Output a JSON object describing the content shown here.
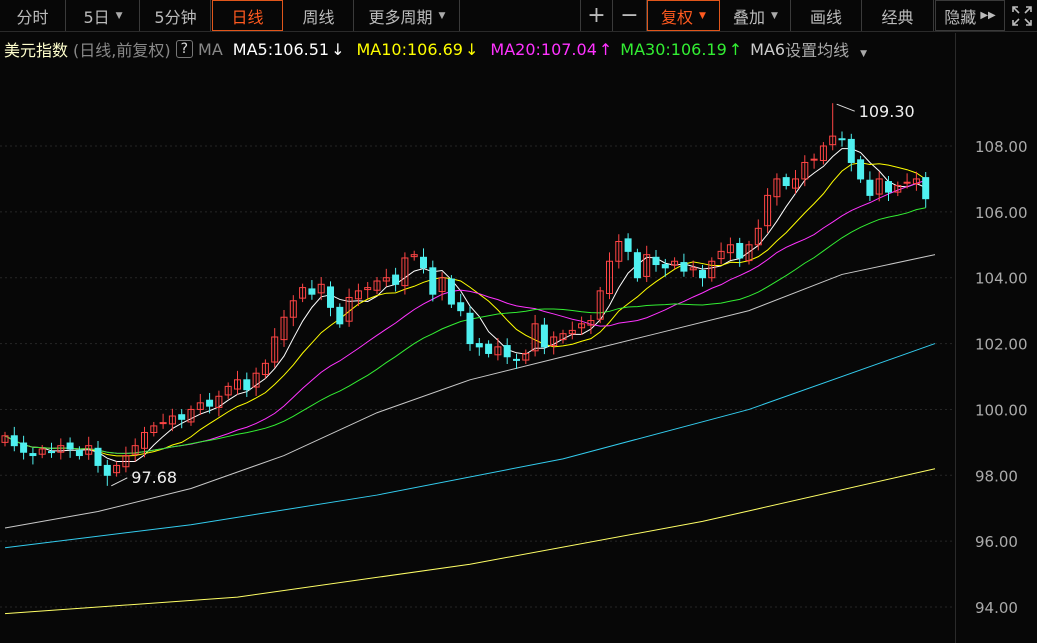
{
  "toolbar": {
    "periods": [
      {
        "label": "分时"
      },
      {
        "label": "5日",
        "dropdown": true
      },
      {
        "label": "5分钟"
      },
      {
        "label": "日线",
        "active": true
      },
      {
        "label": "周线"
      },
      {
        "label": "更多周期",
        "dropdown": true
      }
    ],
    "zoom_in": "+",
    "zoom_out": "−",
    "fuquan": "复权",
    "diejia": "叠加",
    "huaxian": "画线",
    "jingdian": "经典",
    "hide": "隐藏"
  },
  "legend": {
    "name": "美元指数",
    "mode": "(日线,前复权)",
    "help": "?",
    "ma_label": "MA",
    "ma5": "MA5:106.51",
    "ma5_arrow": "↓",
    "ma10": "MA10:106.69",
    "ma10_arrow": "↓",
    "ma20": "MA20:107.04",
    "ma20_arrow": "↑",
    "ma30": "MA30:106.19",
    "ma30_arrow": "↑",
    "ma60": "MA6",
    "settings": "设置均线"
  },
  "colors": {
    "up": "#ff4545",
    "down": "#4ff0f0",
    "ma5": "#ffffff",
    "ma10": "#ffff00",
    "ma20": "#ff33ff",
    "ma30": "#33ee33",
    "ma60": "#c8c8c8",
    "ma120": "#33ccee",
    "ma250": "#ffff66"
  },
  "chart_data": {
    "type": "candlestick",
    "title": "美元指数 日线",
    "ylim": [
      93.6,
      110.5
    ],
    "y_ticks": [
      "108.00",
      "106.00",
      "104.00",
      "102.00",
      "100.00",
      "98.00",
      "96.00",
      "94.00"
    ],
    "y_tick_values": [
      108,
      106,
      104,
      102,
      100,
      98,
      96,
      94
    ],
    "first_open": 99.0,
    "closes": [
      99.2,
      98.9,
      98.7,
      98.6,
      98.8,
      98.7,
      98.9,
      98.8,
      98.6,
      98.9,
      98.3,
      98.0,
      98.3,
      98.6,
      98.9,
      99.3,
      99.5,
      99.6,
      99.8,
      99.7,
      100.0,
      100.2,
      100.1,
      100.4,
      100.7,
      100.9,
      100.6,
      101.1,
      101.4,
      102.2,
      102.8,
      103.3,
      103.7,
      103.5,
      103.8,
      103.1,
      102.6,
      103.4,
      103.6,
      103.7,
      103.9,
      104.0,
      103.8,
      104.6,
      104.7,
      104.3,
      103.5,
      104.0,
      103.2,
      103.0,
      102.0,
      101.9,
      101.7,
      101.9,
      101.6,
      101.5,
      101.7,
      102.6,
      101.9,
      102.2,
      102.3,
      102.4,
      102.6,
      102.7,
      103.6,
      104.5,
      105.1,
      104.8,
      104.0,
      104.7,
      104.4,
      104.3,
      104.5,
      104.2,
      104.3,
      104.0,
      104.5,
      104.8,
      105.0,
      104.6,
      105.0,
      105.5,
      106.5,
      107.0,
      106.8,
      107.0,
      107.5,
      107.6,
      108.0,
      108.3,
      108.2,
      107.5,
      107.0,
      106.5,
      107.0,
      106.6,
      106.8,
      106.9,
      107.0,
      106.4
    ],
    "annotations": [
      {
        "label": "109.30",
        "value": 109.3,
        "index": 89,
        "type": "high"
      },
      {
        "label": "97.68",
        "value": 97.68,
        "index": 11,
        "type": "low"
      }
    ],
    "long_ma": [
      {
        "name": "MA60",
        "points": [
          [
            0,
            96.4
          ],
          [
            10,
            96.9
          ],
          [
            20,
            97.6
          ],
          [
            30,
            98.6
          ],
          [
            40,
            99.9
          ],
          [
            50,
            100.9
          ],
          [
            60,
            101.6
          ],
          [
            70,
            102.3
          ],
          [
            80,
            103.0
          ],
          [
            90,
            104.1
          ],
          [
            100,
            104.7
          ]
        ]
      },
      {
        "name": "MA120",
        "points": [
          [
            0,
            95.8
          ],
          [
            20,
            96.5
          ],
          [
            40,
            97.4
          ],
          [
            60,
            98.5
          ],
          [
            80,
            100.0
          ],
          [
            100,
            102.0
          ]
        ]
      },
      {
        "name": "MA250",
        "points": [
          [
            0,
            93.8
          ],
          [
            25,
            94.3
          ],
          [
            50,
            95.3
          ],
          [
            75,
            96.6
          ],
          [
            100,
            98.2
          ]
        ]
      }
    ]
  }
}
